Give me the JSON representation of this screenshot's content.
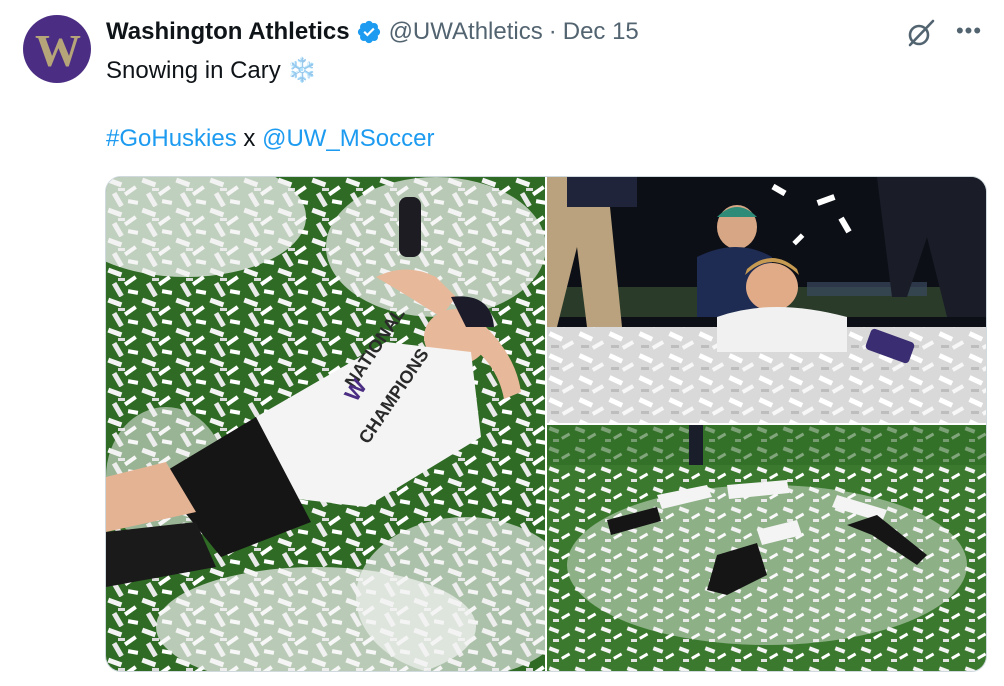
{
  "tweet": {
    "author_name": "Washington Athletics",
    "handle": "@UWAthletics",
    "separator": "·",
    "date": "Dec 15",
    "avatar_letter": "W",
    "line1_text": "Snowing in Cary",
    "line1_emoji": "❄️",
    "hashtag": "#GoHuskies",
    "connector": "x",
    "mention": "@UW_MSoccer",
    "more_label": "•••",
    "photo1_shirt_text": "NATIONAL CHAMPIONS"
  },
  "colors": {
    "brand_purple": "#4b2e83",
    "brand_gold": "#b7a57a",
    "link_blue": "#1d9bf0",
    "secondary_text": "#536471",
    "turf_green": "#2f6b25"
  },
  "icons": {
    "verified": "verified-badge-icon",
    "grok": "grok-icon",
    "more": "more-options-icon"
  },
  "media": {
    "photos": [
      {
        "description": "player-in-confetti"
      },
      {
        "description": "confetti-celebration-closeup"
      },
      {
        "description": "players-making-snow-angels"
      }
    ]
  }
}
